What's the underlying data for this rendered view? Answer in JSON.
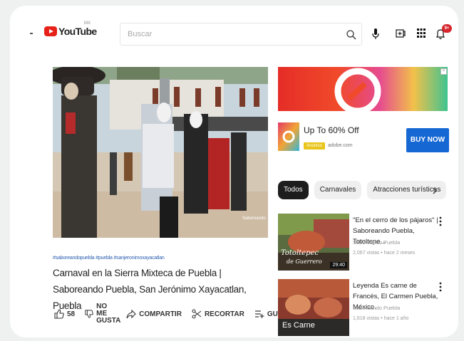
{
  "header": {
    "logo_text": "YouTube",
    "logo_country": "MX",
    "search_placeholder": "Buscar",
    "notification_count": "9+"
  },
  "video": {
    "hashtags": "#saboreandopuebla #puebla #sanjeronimoxayacatlan",
    "title": "Carnaval en la Sierra Mixteca de Puebla | Saboreando Puebla, San Jerónimo Xayacatlan, Puebla",
    "likes": "58",
    "dislike_label_1": "NO ME",
    "dislike_label_2": "GUSTA",
    "share_label": "COMPARTIR",
    "clip_label": "RECORTAR",
    "save_label": "GUARDAR"
  },
  "ad": {
    "headline": "Up To 60% Off",
    "tag": "Anuncio",
    "domain": "adobe.com",
    "cta": "BUY NOW"
  },
  "chips": [
    "Todos",
    "Carnavales",
    "Atracciones turísticas"
  ],
  "recommendations": [
    {
      "title": "\"En el cerro de los pájaros\" | Saboreando Puebla, Totoltepe...",
      "channel": "Saboreando Puebla",
      "meta": "2,067 vistas • hace 2 meses",
      "duration": "29:40",
      "thumb_text_1": "Totoltepec",
      "thumb_text_2": "de Guerrero"
    },
    {
      "title": "Leyenda Es carne de Francés, El Carmen Puebla, México.",
      "channel": "Saboreando Puebla",
      "meta": "1,618 vistas • hace 1 año",
      "duration": "",
      "thumb_text_1": "Es Carne",
      "thumb_text_2": ""
    }
  ],
  "colors": {
    "brand_red": "#e62117",
    "cta_blue": "#1567d3",
    "hashtag_blue": "#2b5fb0"
  }
}
